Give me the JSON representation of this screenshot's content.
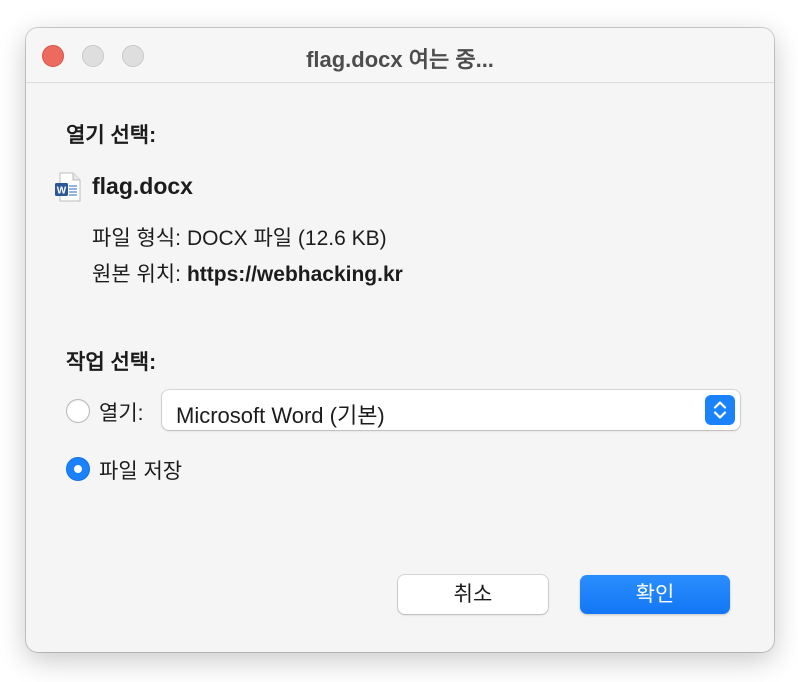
{
  "window": {
    "title": "flag.docx 여는 중..."
  },
  "open_section": {
    "label": "열기 선택:",
    "file": {
      "name": "flag.docx",
      "icon": "word-document-icon",
      "type_label": "파일 형식:",
      "type_value": "DOCX 파일 (12.6 KB)",
      "source_label": "원본 위치:",
      "source_value": "https://webhacking.kr"
    }
  },
  "action_section": {
    "label": "작업 선택:",
    "open_option": {
      "label": "열기:",
      "selected": false,
      "app_select_value": "Microsoft Word (기본)"
    },
    "save_option": {
      "label": "파일 저장",
      "selected": true
    }
  },
  "buttons": {
    "cancel": "취소",
    "ok": "확인"
  },
  "colors": {
    "accent": "#1a82fb",
    "close": "#ed6a5e",
    "word_blue": "#2b5797"
  }
}
